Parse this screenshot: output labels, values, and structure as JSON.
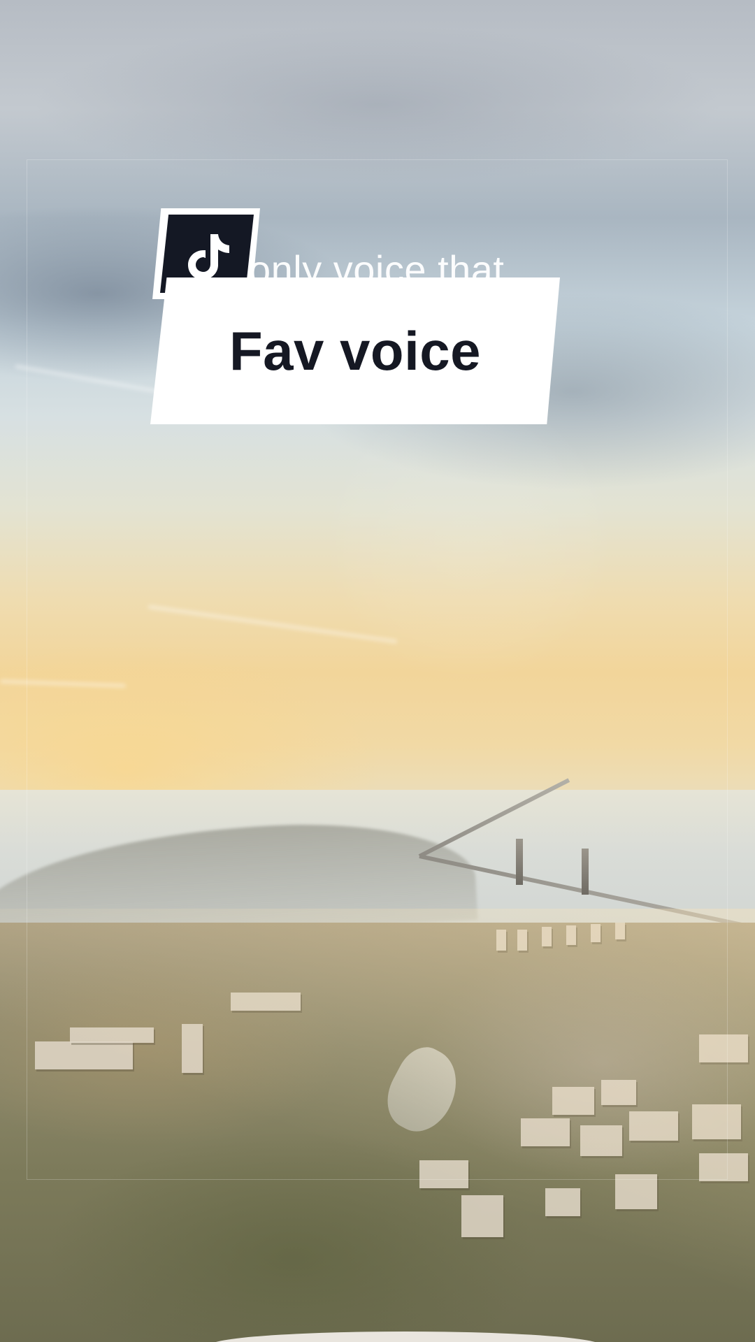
{
  "overlay": {
    "logo_icon": "tiktok-note-icon",
    "ghost_text": "only voice that",
    "caption": "Fav voice"
  },
  "colors": {
    "logo_bg": "#141824",
    "logo_border": "#ffffff",
    "caption_bg": "#ffffff",
    "caption_text": "#151823"
  }
}
